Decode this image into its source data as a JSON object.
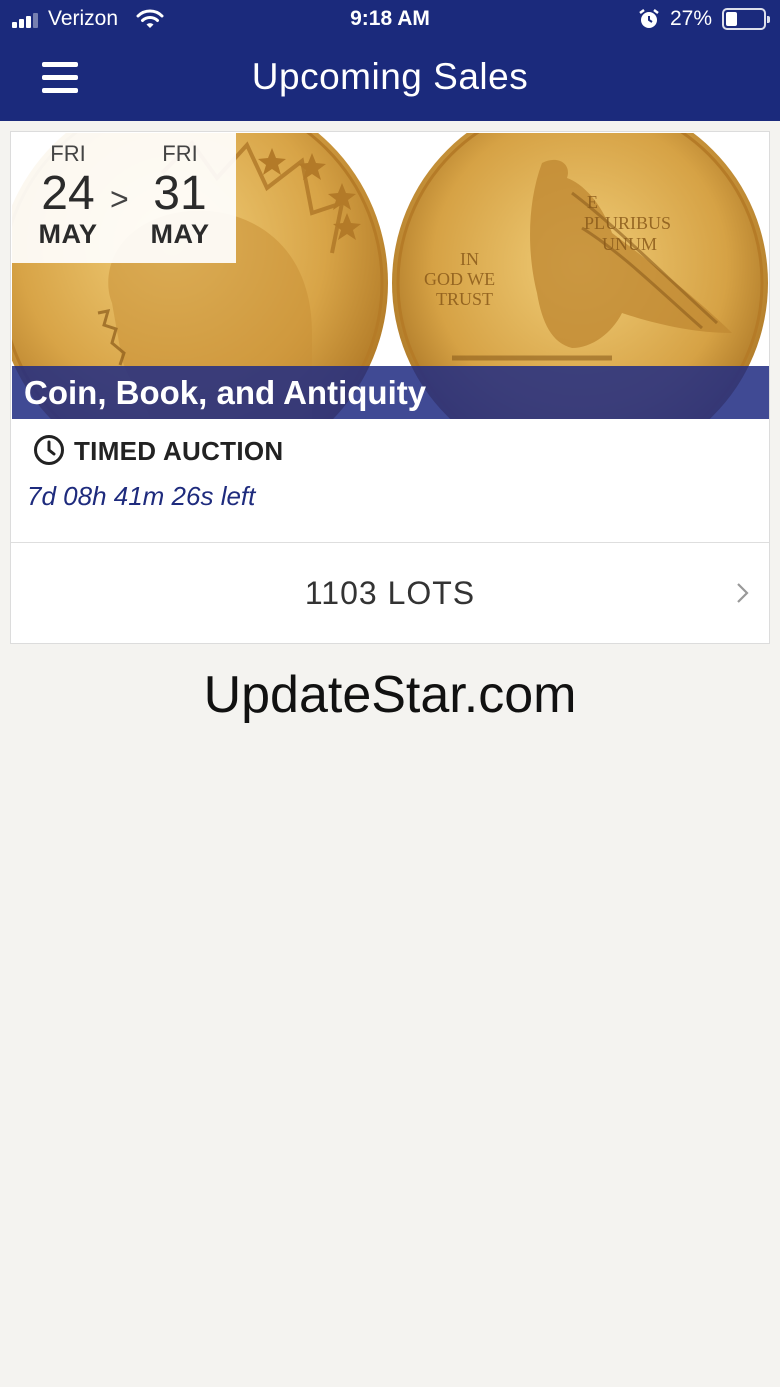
{
  "status_bar": {
    "carrier": "Verizon",
    "time": "9:18 AM",
    "battery_percent": "27%",
    "battery_level": 0.27,
    "signal_icon": "cellular-signal-icon",
    "wifi_icon": "wifi-icon",
    "alarm_icon": "alarm-clock-icon"
  },
  "nav": {
    "title": "Upcoming Sales",
    "menu_icon": "hamburger-menu-icon",
    "bar_color": "#1b2a7c"
  },
  "sale": {
    "start": {
      "dow": "FRI",
      "day": "24",
      "month": "MAY"
    },
    "separator": ">",
    "end": {
      "dow": "FRI",
      "day": "31",
      "month": "MAY"
    },
    "title": "Coin, Book, and Antiquity",
    "image_icon": "gold-coin-image",
    "type": "TIMED AUCTION",
    "type_icon": "clock-icon",
    "countdown": "7d 08h 41m 26s left",
    "lots": "1103 LOTS",
    "lots_icon": "chevron-right-icon"
  },
  "watermark": "UpdateStar.com",
  "colors": {
    "accent": "#1b2a7c",
    "background": "#f4f3f0",
    "gold": "#d9a84a"
  }
}
